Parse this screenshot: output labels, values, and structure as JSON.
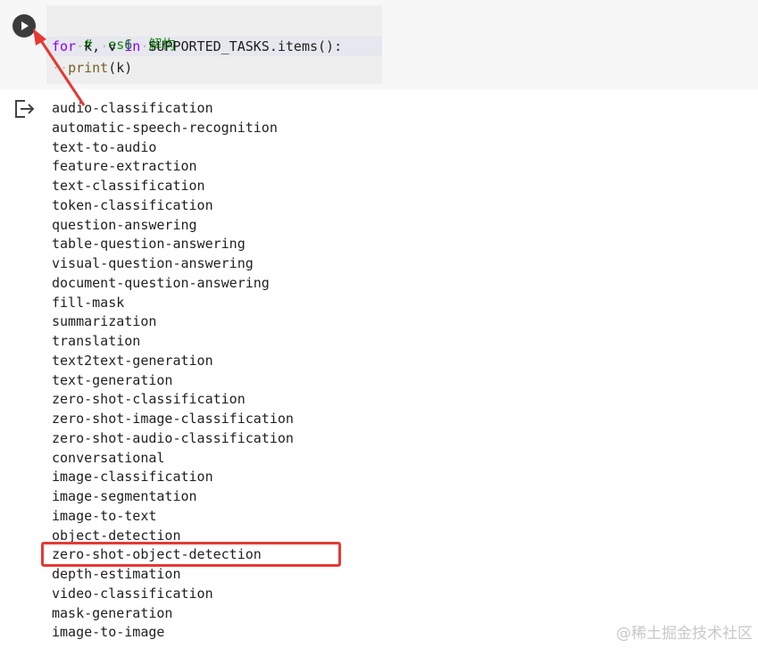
{
  "code_cell": {
    "run_button": "run-cell",
    "lines": {
      "comment": "#  es6  解构",
      "for_kw": "for",
      "loop_vars": "k,",
      "v_var": "v",
      "in_kw": "in",
      "iterable": "SUPPORTED_TASKS.items",
      "call_parens": "():",
      "print_fn": "print",
      "print_args": "(k)"
    }
  },
  "output": {
    "icon": "output-redirect-icon",
    "items": [
      "audio-classification",
      "automatic-speech-recognition",
      "text-to-audio",
      "feature-extraction",
      "text-classification",
      "token-classification",
      "question-answering",
      "table-question-answering",
      "visual-question-answering",
      "document-question-answering",
      "fill-mask",
      "summarization",
      "translation",
      "text2text-generation",
      "text-generation",
      "zero-shot-classification",
      "zero-shot-image-classification",
      "zero-shot-audio-classification",
      "conversational",
      "image-classification",
      "image-segmentation",
      "image-to-text",
      "object-detection",
      "zero-shot-object-detection",
      "depth-estimation",
      "video-classification",
      "mask-generation",
      "image-to-image"
    ]
  },
  "annotations": {
    "highlight_color": "#e53935",
    "highlighted_item": "zero-shot-object-detection"
  },
  "watermark": "@稀土掘金技术社区"
}
